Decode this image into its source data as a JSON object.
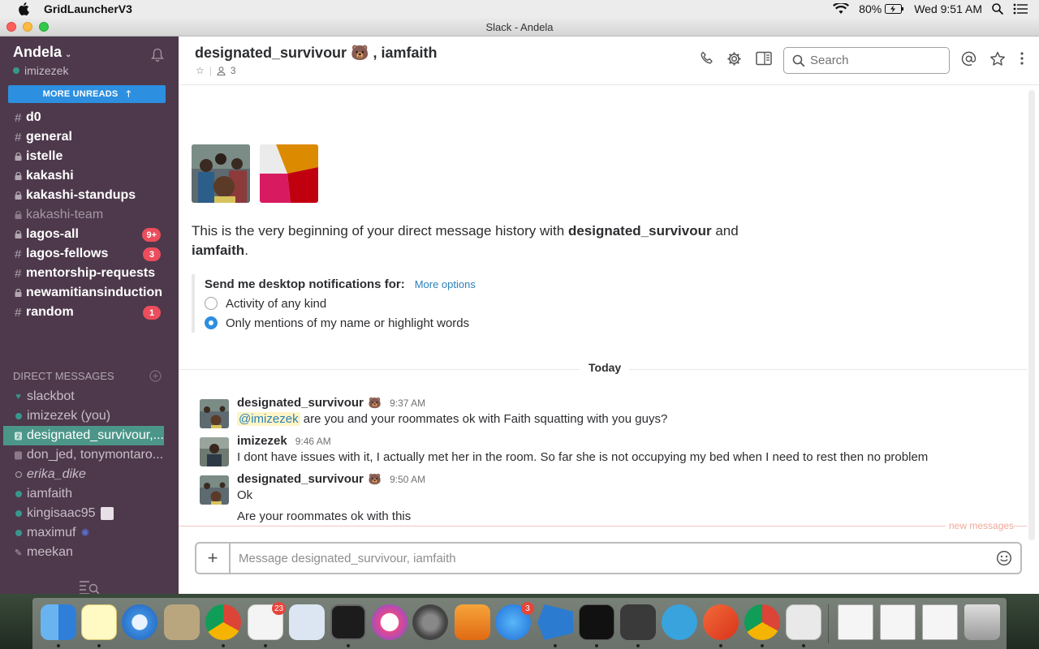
{
  "menubar": {
    "app_name": "GridLauncherV3",
    "battery": "80%",
    "clock": "Wed 9:51 AM"
  },
  "window": {
    "title": "Slack - Andela"
  },
  "sidebar": {
    "team": "Andela",
    "user": "imizezek",
    "more_unreads": "MORE UNREADS",
    "channels": [
      {
        "sym": "#",
        "name": "d0",
        "muted": false,
        "badge": ""
      },
      {
        "sym": "#",
        "name": "general",
        "muted": false,
        "badge": ""
      },
      {
        "sym": "lock",
        "name": "istelle",
        "muted": false,
        "badge": ""
      },
      {
        "sym": "lock",
        "name": "kakashi",
        "muted": false,
        "badge": ""
      },
      {
        "sym": "lock",
        "name": "kakashi-standups",
        "muted": false,
        "badge": ""
      },
      {
        "sym": "lock",
        "name": "kakashi-team",
        "muted": true,
        "badge": ""
      },
      {
        "sym": "lock",
        "name": "lagos-all",
        "muted": false,
        "badge": "9+"
      },
      {
        "sym": "#",
        "name": "lagos-fellows",
        "muted": false,
        "badge": "3"
      },
      {
        "sym": "#",
        "name": "mentorship-requests",
        "muted": false,
        "badge": ""
      },
      {
        "sym": "lock",
        "name": "newamitiansinduction",
        "muted": false,
        "badge": ""
      },
      {
        "sym": "#",
        "name": "random",
        "muted": false,
        "badge": "1"
      }
    ],
    "dm_header": "DIRECT MESSAGES",
    "dms": [
      {
        "name": "slackbot",
        "status": "heart"
      },
      {
        "name": "imizezek (you)",
        "status": "online"
      },
      {
        "name": "designated_survivour,...",
        "status": "group"
      },
      {
        "name": "don_jed, tonymontaro...",
        "status": "group-away"
      },
      {
        "name": "erika_dike",
        "status": "away"
      },
      {
        "name": "iamfaith",
        "status": "online"
      },
      {
        "name": "kingisaac95",
        "status": "online"
      },
      {
        "name": "maximuf",
        "status": "online"
      },
      {
        "name": "meekan",
        "status": "app"
      }
    ]
  },
  "header": {
    "title": "designated_survivour 🐻 , iamfaith",
    "members": "3",
    "search_placeholder": "Search"
  },
  "conversation": {
    "intro_prefix": "This is the very beginning of your direct message history with ",
    "intro_user1": "designated_survivour",
    "intro_mid": " and ",
    "intro_user2": "iamfaith",
    "intro_end": ".",
    "notif_title": "Send me desktop notifications for:",
    "more_options": "More options",
    "option_any": "Activity of any kind",
    "option_mentions": "Only mentions of my name or highlight words",
    "selected_option": "mentions",
    "today": "Today",
    "new_messages": "new messages",
    "messages": [
      {
        "user": "designated_survivour",
        "time": "9:37 AM",
        "mention": "@imizezek",
        "text": " are you and your roommates ok with Faith squatting with you guys?"
      },
      {
        "user": "imizezek",
        "time": "9:46 AM",
        "text": "I dont have issues with it, I actually met her in the room. So far she is not occupying my bed when I need to rest then no problem"
      },
      {
        "user": "designated_survivour",
        "time": "9:50 AM",
        "text": "Ok",
        "text2": "Are your roommates ok with this"
      }
    ]
  },
  "composer": {
    "placeholder": "Message designated_survivour, iamfaith"
  },
  "dock": {
    "badges": {
      "slack": "23",
      "appstore": "3"
    }
  },
  "colors": {
    "sidebar_bg": "#4d394b",
    "active_dm": "#4c9689",
    "unreads_bar": "#2d8fe0",
    "badge": "#eb4d5c",
    "link": "#2a80b9"
  }
}
